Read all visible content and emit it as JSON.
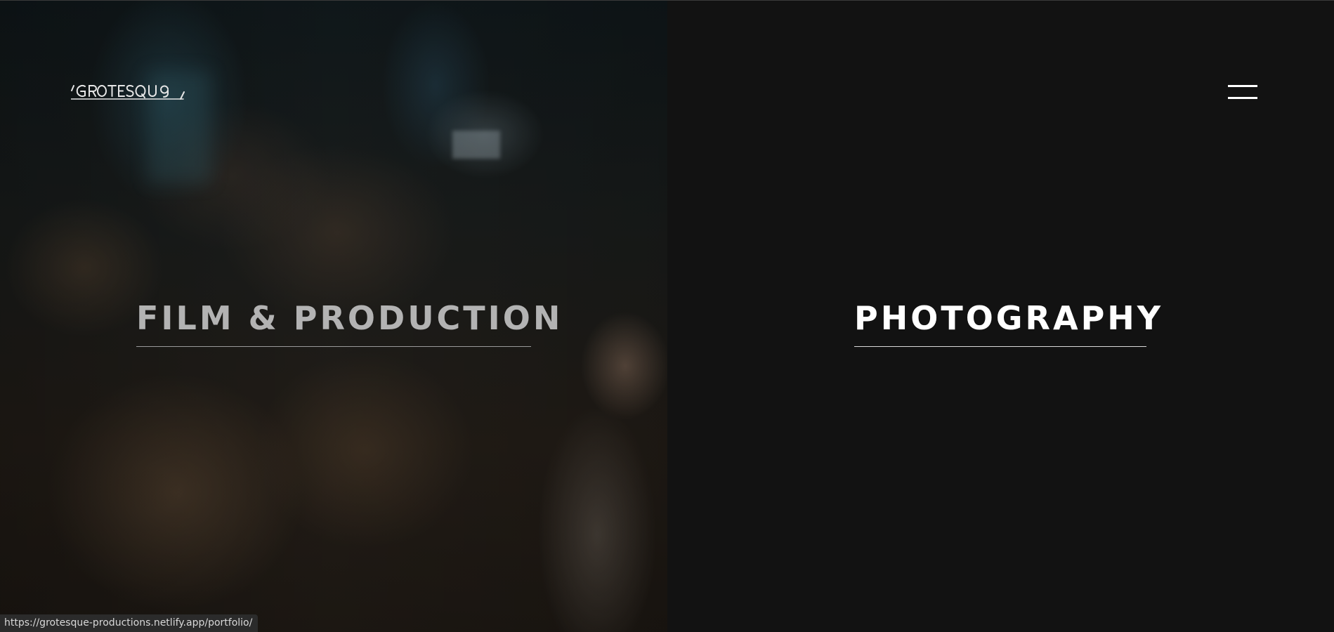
{
  "brand": {
    "logo_text": "GROTESQUE"
  },
  "nav": {
    "menu_icon": "hamburger-menu-icon"
  },
  "categories": [
    {
      "label": "FILM & PRODUCTION"
    },
    {
      "label": "PHOTOGRAPHY"
    }
  ],
  "status_bar": {
    "url": "https://grotesque-productions.netlify.app/portfolio/"
  },
  "colors": {
    "background": "#121212",
    "text_primary": "#ffffff",
    "text_muted": "#b3b3b3"
  }
}
